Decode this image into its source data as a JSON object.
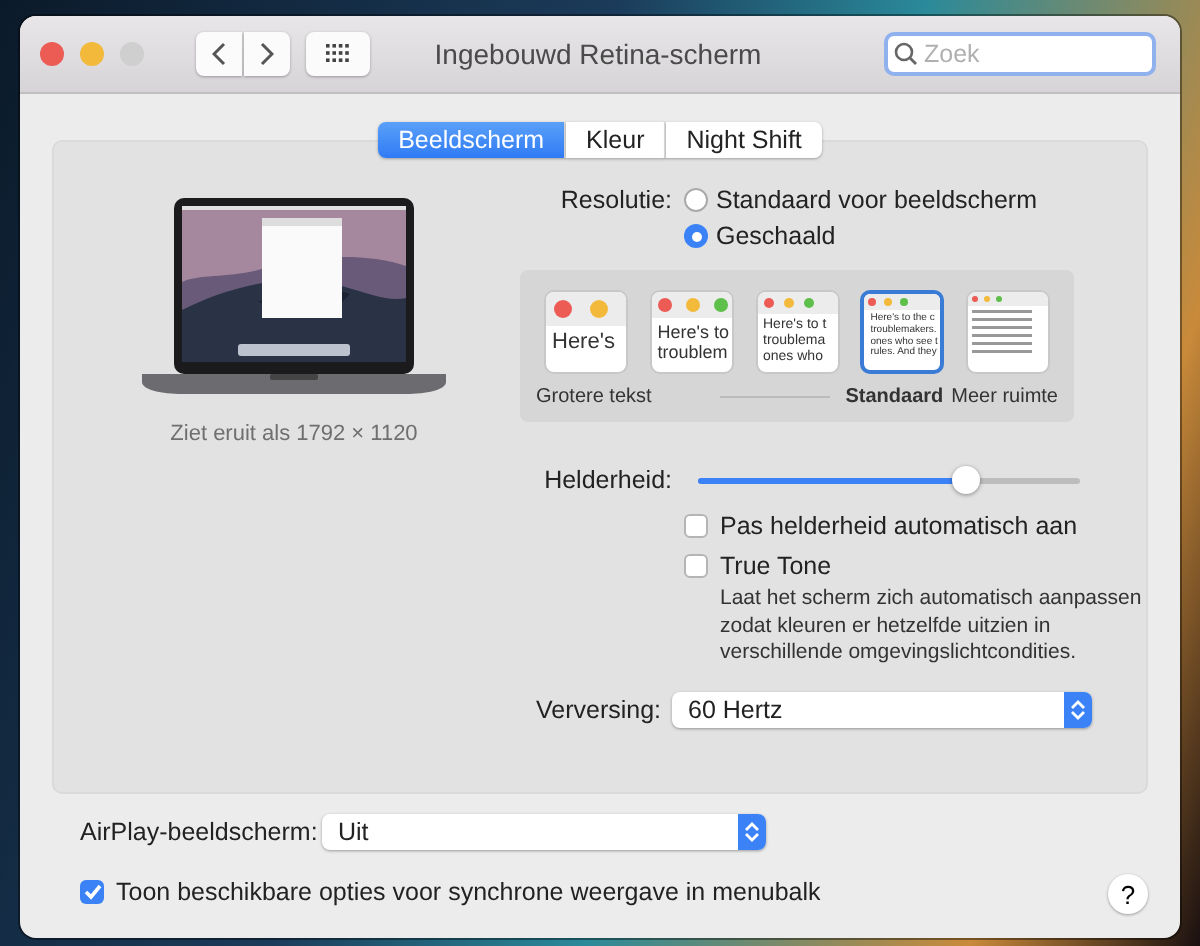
{
  "window": {
    "title": "Ingebouwd Retina-scherm",
    "search": {
      "placeholder": "Zoek"
    }
  },
  "tabs": [
    {
      "label": "Beeldscherm",
      "selected": true
    },
    {
      "label": "Kleur",
      "selected": false
    },
    {
      "label": "Night Shift",
      "selected": false
    }
  ],
  "display": {
    "caption": "Ziet eruit als 1792 × 1120"
  },
  "resolution": {
    "label": "Resolutie:",
    "options": [
      {
        "label": "Standaard voor beeldscherm",
        "selected": false
      },
      {
        "label": "Geschaald",
        "selected": true
      }
    ],
    "scales": [
      {
        "selected": false,
        "preview": [
          "Here's"
        ]
      },
      {
        "selected": false,
        "preview": [
          "Here's to",
          "troublem"
        ]
      },
      {
        "selected": false,
        "preview": [
          "Here's to t",
          "troublema",
          "ones who"
        ]
      },
      {
        "selected": true,
        "preview": [
          "Here's to the c",
          "troublemakers.",
          "ones who see t",
          "rules. And they"
        ]
      },
      {
        "selected": false
      }
    ],
    "left_label": "Grotere tekst",
    "middle_label": "Standaard",
    "right_label": "Meer ruimte"
  },
  "brightness": {
    "label": "Helderheid:",
    "level": 0.7
  },
  "checks": [
    {
      "label": "Pas helderheid automatisch aan",
      "checked": false
    },
    {
      "label": "True Tone",
      "checked": false,
      "description": "Laat het scherm zich automatisch aanpassen zodat kleuren er hetzelfde uitzien in verschillende omgevingslichtcondities."
    }
  ],
  "refresh": {
    "label": "Verversing:",
    "value": "60 Hertz"
  },
  "airplay": {
    "label": "AirPlay-beeldscherm:",
    "value": "Uit"
  },
  "mirror_option": {
    "label": "Toon beschikbare opties voor synchrone weergave in menubalk",
    "checked": true
  },
  "help": "?"
}
